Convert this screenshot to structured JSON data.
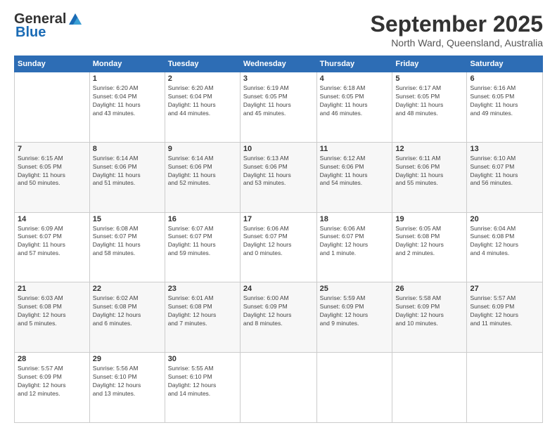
{
  "header": {
    "logo_general": "General",
    "logo_blue": "Blue",
    "month": "September 2025",
    "location": "North Ward, Queensland, Australia"
  },
  "calendar": {
    "days": [
      "Sunday",
      "Monday",
      "Tuesday",
      "Wednesday",
      "Thursday",
      "Friday",
      "Saturday"
    ],
    "weeks": [
      [
        {
          "num": "",
          "info": ""
        },
        {
          "num": "1",
          "info": "Sunrise: 6:20 AM\nSunset: 6:04 PM\nDaylight: 11 hours\nand 43 minutes."
        },
        {
          "num": "2",
          "info": "Sunrise: 6:20 AM\nSunset: 6:04 PM\nDaylight: 11 hours\nand 44 minutes."
        },
        {
          "num": "3",
          "info": "Sunrise: 6:19 AM\nSunset: 6:05 PM\nDaylight: 11 hours\nand 45 minutes."
        },
        {
          "num": "4",
          "info": "Sunrise: 6:18 AM\nSunset: 6:05 PM\nDaylight: 11 hours\nand 46 minutes."
        },
        {
          "num": "5",
          "info": "Sunrise: 6:17 AM\nSunset: 6:05 PM\nDaylight: 11 hours\nand 48 minutes."
        },
        {
          "num": "6",
          "info": "Sunrise: 6:16 AM\nSunset: 6:05 PM\nDaylight: 11 hours\nand 49 minutes."
        }
      ],
      [
        {
          "num": "7",
          "info": "Sunrise: 6:15 AM\nSunset: 6:05 PM\nDaylight: 11 hours\nand 50 minutes."
        },
        {
          "num": "8",
          "info": "Sunrise: 6:14 AM\nSunset: 6:06 PM\nDaylight: 11 hours\nand 51 minutes."
        },
        {
          "num": "9",
          "info": "Sunrise: 6:14 AM\nSunset: 6:06 PM\nDaylight: 11 hours\nand 52 minutes."
        },
        {
          "num": "10",
          "info": "Sunrise: 6:13 AM\nSunset: 6:06 PM\nDaylight: 11 hours\nand 53 minutes."
        },
        {
          "num": "11",
          "info": "Sunrise: 6:12 AM\nSunset: 6:06 PM\nDaylight: 11 hours\nand 54 minutes."
        },
        {
          "num": "12",
          "info": "Sunrise: 6:11 AM\nSunset: 6:06 PM\nDaylight: 11 hours\nand 55 minutes."
        },
        {
          "num": "13",
          "info": "Sunrise: 6:10 AM\nSunset: 6:07 PM\nDaylight: 11 hours\nand 56 minutes."
        }
      ],
      [
        {
          "num": "14",
          "info": "Sunrise: 6:09 AM\nSunset: 6:07 PM\nDaylight: 11 hours\nand 57 minutes."
        },
        {
          "num": "15",
          "info": "Sunrise: 6:08 AM\nSunset: 6:07 PM\nDaylight: 11 hours\nand 58 minutes."
        },
        {
          "num": "16",
          "info": "Sunrise: 6:07 AM\nSunset: 6:07 PM\nDaylight: 11 hours\nand 59 minutes."
        },
        {
          "num": "17",
          "info": "Sunrise: 6:06 AM\nSunset: 6:07 PM\nDaylight: 12 hours\nand 0 minutes."
        },
        {
          "num": "18",
          "info": "Sunrise: 6:06 AM\nSunset: 6:07 PM\nDaylight: 12 hours\nand 1 minute."
        },
        {
          "num": "19",
          "info": "Sunrise: 6:05 AM\nSunset: 6:08 PM\nDaylight: 12 hours\nand 2 minutes."
        },
        {
          "num": "20",
          "info": "Sunrise: 6:04 AM\nSunset: 6:08 PM\nDaylight: 12 hours\nand 4 minutes."
        }
      ],
      [
        {
          "num": "21",
          "info": "Sunrise: 6:03 AM\nSunset: 6:08 PM\nDaylight: 12 hours\nand 5 minutes."
        },
        {
          "num": "22",
          "info": "Sunrise: 6:02 AM\nSunset: 6:08 PM\nDaylight: 12 hours\nand 6 minutes."
        },
        {
          "num": "23",
          "info": "Sunrise: 6:01 AM\nSunset: 6:08 PM\nDaylight: 12 hours\nand 7 minutes."
        },
        {
          "num": "24",
          "info": "Sunrise: 6:00 AM\nSunset: 6:09 PM\nDaylight: 12 hours\nand 8 minutes."
        },
        {
          "num": "25",
          "info": "Sunrise: 5:59 AM\nSunset: 6:09 PM\nDaylight: 12 hours\nand 9 minutes."
        },
        {
          "num": "26",
          "info": "Sunrise: 5:58 AM\nSunset: 6:09 PM\nDaylight: 12 hours\nand 10 minutes."
        },
        {
          "num": "27",
          "info": "Sunrise: 5:57 AM\nSunset: 6:09 PM\nDaylight: 12 hours\nand 11 minutes."
        }
      ],
      [
        {
          "num": "28",
          "info": "Sunrise: 5:57 AM\nSunset: 6:09 PM\nDaylight: 12 hours\nand 12 minutes."
        },
        {
          "num": "29",
          "info": "Sunrise: 5:56 AM\nSunset: 6:10 PM\nDaylight: 12 hours\nand 13 minutes."
        },
        {
          "num": "30",
          "info": "Sunrise: 5:55 AM\nSunset: 6:10 PM\nDaylight: 12 hours\nand 14 minutes."
        },
        {
          "num": "",
          "info": ""
        },
        {
          "num": "",
          "info": ""
        },
        {
          "num": "",
          "info": ""
        },
        {
          "num": "",
          "info": ""
        }
      ]
    ]
  }
}
